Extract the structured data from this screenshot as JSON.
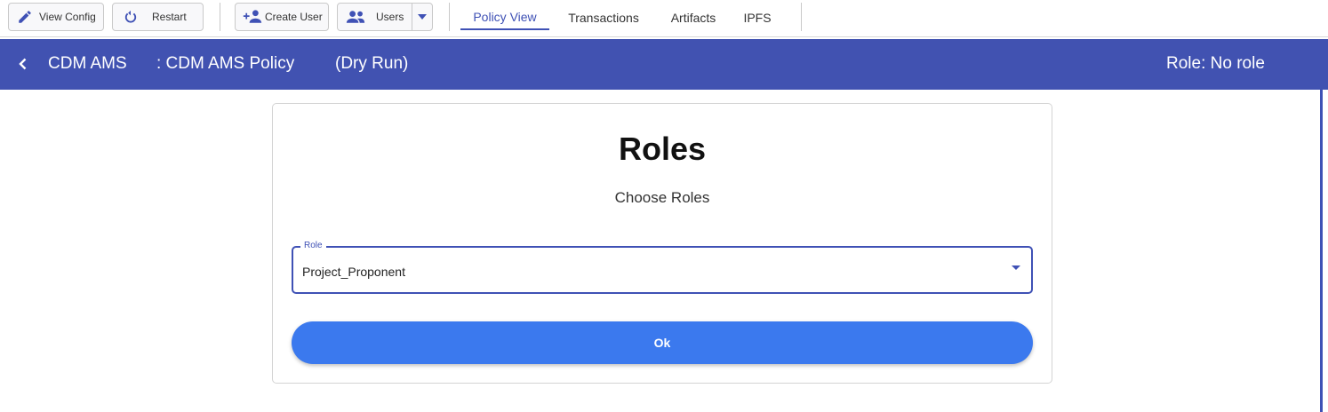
{
  "toolbar": {
    "view_config": {
      "label": "View Config",
      "icon": "pencil-icon"
    },
    "restart": {
      "label": "Restart",
      "icon": "restart-icon"
    },
    "create_user": {
      "label": "Create User",
      "icon": "add-user-icon"
    },
    "users": {
      "label": "Users",
      "icon": "users-icon",
      "dropdown_icon": "caret-down-icon"
    }
  },
  "tabs": [
    {
      "label": "Policy View",
      "active": true
    },
    {
      "label": "Transactions",
      "active": false
    },
    {
      "label": "Artifacts",
      "active": false
    },
    {
      "label": "IPFS",
      "active": false
    }
  ],
  "header": {
    "back_icon": "chevron-left-icon",
    "policy_name": "CDM AMS",
    "policy_title": ": CDM AMS Policy",
    "mode": "(Dry Run)",
    "role_status": "Role: No role"
  },
  "card": {
    "title": "Roles",
    "subtitle": "Choose Roles",
    "role_select": {
      "label": "Role",
      "value": "Project_Proponent"
    },
    "ok_label": "Ok"
  },
  "colors": {
    "header_bg": "#4152b1",
    "accent": "#3f51b5",
    "ok_button": "#3b79ee"
  }
}
